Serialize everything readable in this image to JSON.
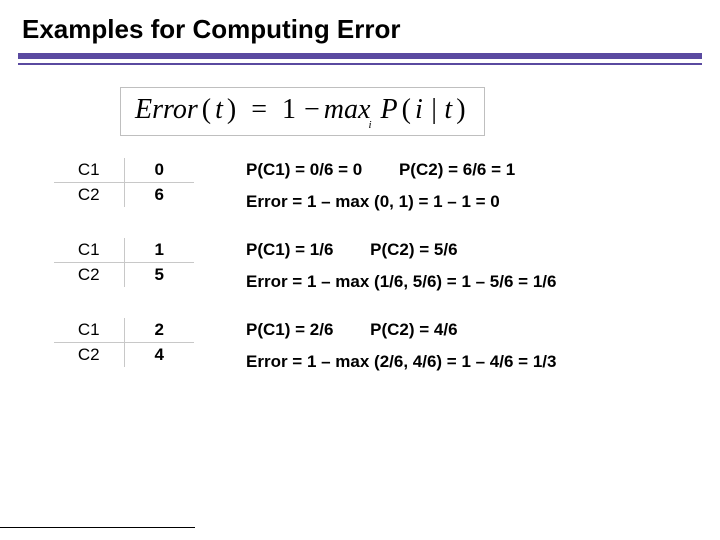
{
  "title": "Examples for Computing Error",
  "formula": {
    "lhs": "Error",
    "arg": "t",
    "eq": "=",
    "one": "1",
    "minus": "−",
    "max": "max",
    "sub": "i",
    "P": "P",
    "cond": "i | t"
  },
  "blocks": [
    {
      "rows": [
        {
          "label": "C1",
          "value": "0"
        },
        {
          "label": "C2",
          "value": "6"
        }
      ],
      "pc1": "P(C1) = 0/6 = 0",
      "pc2": "P(C2) = 6/6 = 1",
      "err": "Error = 1 – max (0, 1) = 1 – 1 = 0"
    },
    {
      "rows": [
        {
          "label": "C1",
          "value": "1"
        },
        {
          "label": "C2",
          "value": "5"
        }
      ],
      "pc1": "P(C1) = 1/6",
      "pc2": "P(C2) = 5/6",
      "err": "Error = 1 – max (1/6, 5/6) = 1 – 5/6 = 1/6"
    },
    {
      "rows": [
        {
          "label": "C1",
          "value": "2"
        },
        {
          "label": "C2",
          "value": "4"
        }
      ],
      "pc1": "P(C1) = 2/6",
      "pc2": "P(C2) = 4/6",
      "err": "Error = 1 – max (2/6, 4/6) = 1 – 4/6 = 1/3"
    }
  ]
}
